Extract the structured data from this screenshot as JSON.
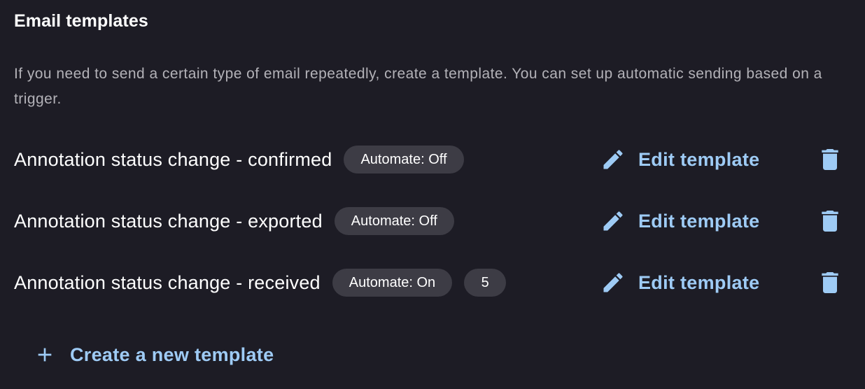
{
  "section": {
    "title": "Email templates",
    "description": "If you need to send a certain type of email repeatedly, create a template. You can set up automatic sending based on a trigger."
  },
  "templates": [
    {
      "name": "Annotation status change - confirmed",
      "automate": "Automate: Off",
      "count": null,
      "edit_label": "Edit template",
      "edit_icon": "pencil-icon",
      "delete_icon": "trash-icon"
    },
    {
      "name": "Annotation status change - exported",
      "automate": "Automate: Off",
      "count": null,
      "edit_label": "Edit template",
      "edit_icon": "pencil-icon",
      "delete_icon": "trash-icon"
    },
    {
      "name": "Annotation status change - received",
      "automate": "Automate: On",
      "count": "5",
      "edit_label": "Edit template",
      "edit_icon": "pencil-icon",
      "delete_icon": "trash-icon"
    }
  ],
  "create": {
    "label": "Create a new template",
    "icon": "plus-icon"
  },
  "colors": {
    "background": "#1d1c25",
    "accent": "#9ecbf5",
    "chip_background": "#3d3c45",
    "secondary_text": "#b3b2b8"
  }
}
